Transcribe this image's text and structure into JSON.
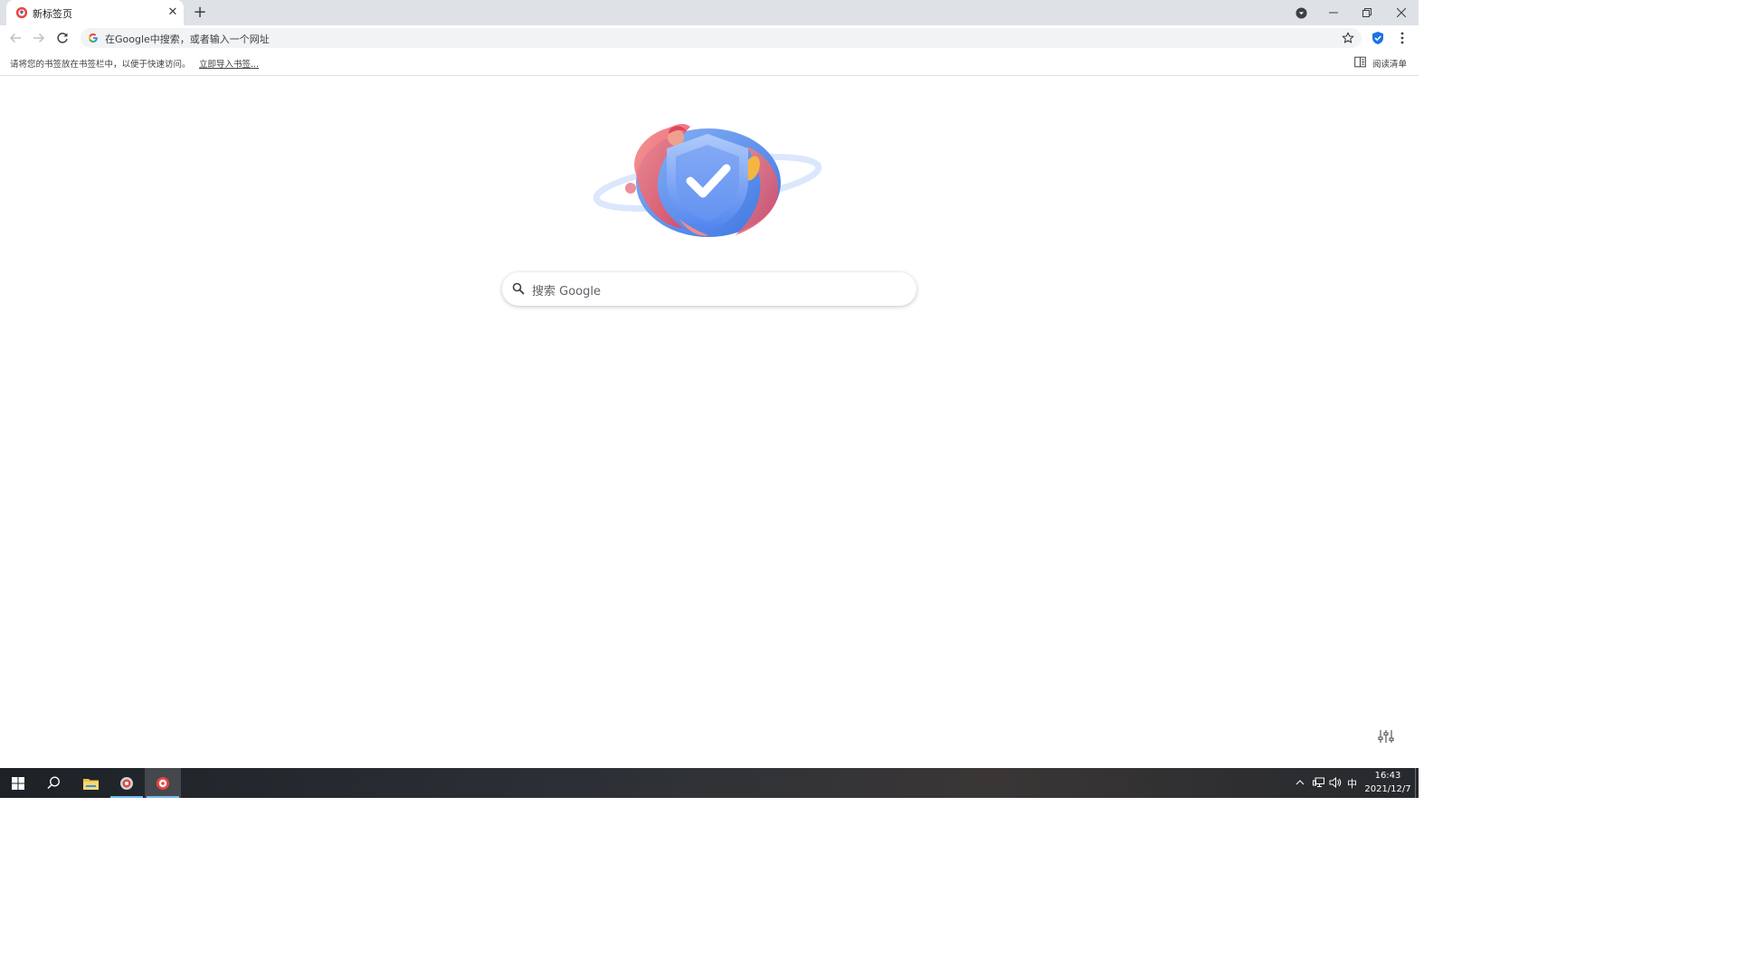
{
  "tab": {
    "title": "新标签页",
    "close_glyph": "✕",
    "favicon": "browser-logo-icon"
  },
  "new_tab_glyph": "+",
  "window_controls": {
    "minimize": "—",
    "restore": "❐",
    "close": "✕"
  },
  "toolbar": {
    "omnibox_placeholder": "在Google中搜索，或者输入一个网址",
    "icons": [
      "back-arrow-icon",
      "forward-arrow-icon",
      "reload-icon",
      "google-g-icon",
      "bookmark-star-icon",
      "shield-extension-icon",
      "kebab-menu-icon"
    ]
  },
  "bookmarks_bar": {
    "hint": "请将您的书签放在书签栏中，以便于快速访问。",
    "import_link": "立即导入书签...",
    "reading_list": "阅读清单"
  },
  "search": {
    "placeholder": "搜索 Google"
  },
  "taskbar": {
    "ime": "中",
    "time": "16:43",
    "date": "2021/12/7"
  },
  "colors": {
    "tabstrip": "#dee1e6",
    "omnibox": "#f1f3f4",
    "accent_blue": "#1a73e8",
    "taskbar_highlight": "#76b9ed"
  }
}
